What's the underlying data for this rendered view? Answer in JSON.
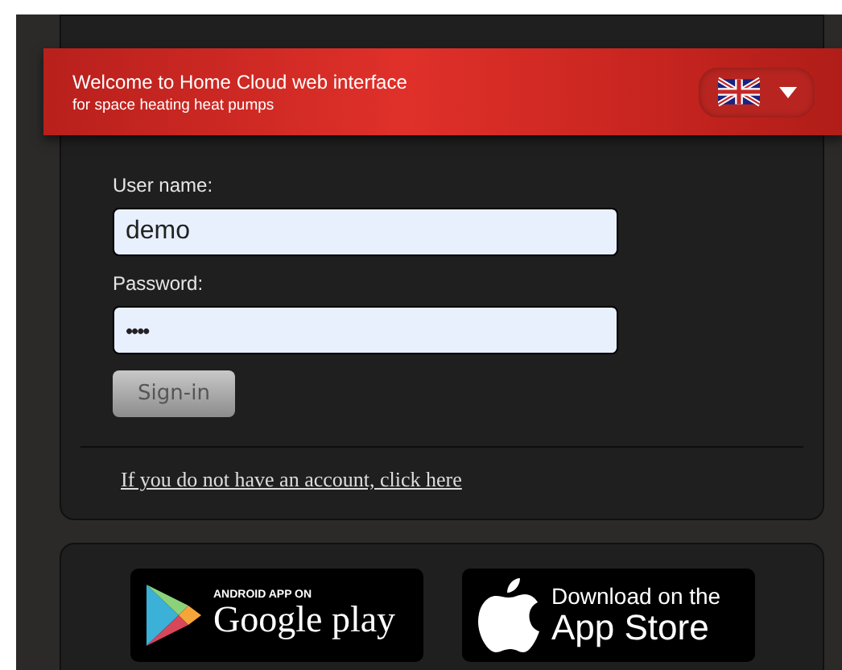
{
  "banner": {
    "title": "Welcome to Home Cloud web interface",
    "subtitle": "for space heating heat pumps"
  },
  "login": {
    "fields": [
      {
        "label": "User name:",
        "value": "demo",
        "kind": "text"
      },
      {
        "label": "Password:",
        "value": "••••",
        "kind": "password"
      }
    ],
    "button": "Sign-in",
    "register_link": "If you do not have an account, click here"
  },
  "stores": [
    {
      "kind": "google",
      "small": "ANDROID APP ON",
      "big": "Google play"
    },
    {
      "kind": "apple",
      "small": "Download on the",
      "big": "App Store"
    }
  ]
}
